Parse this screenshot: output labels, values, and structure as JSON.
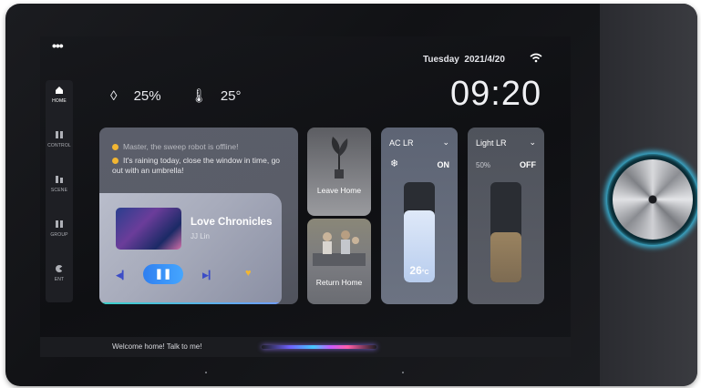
{
  "top": {
    "menu_dots": "•••"
  },
  "nav": {
    "items": [
      {
        "label": "HOME",
        "icon": "home-icon",
        "active": true
      },
      {
        "label": "CONTROL",
        "icon": "control-icon",
        "active": false
      },
      {
        "label": "SCENE",
        "icon": "scene-icon",
        "active": false
      },
      {
        "label": "GROUP",
        "icon": "group-icon",
        "active": false
      },
      {
        "label": "ENT",
        "icon": "entertainment-icon",
        "active": false
      }
    ]
  },
  "weather": {
    "humidity": "25%",
    "temperature": "25°"
  },
  "status": {
    "day": "Tuesday",
    "date": "2021/4/20",
    "time": "09:20",
    "wifi_icon": "wifi-icon"
  },
  "messages": [
    "Master, the sweep robot is offline!",
    "It's raining today, close the window in time, go out with an umbrella!"
  ],
  "music": {
    "title": "Love Chronicles",
    "artist": "JJ Lin",
    "prev_icon": "prev-icon",
    "play_icon": "pause-icon",
    "next_icon": "next-icon",
    "favorite_icon": "heart-icon"
  },
  "scenes": [
    {
      "label": "Leave Home"
    },
    {
      "label": "Return Home"
    }
  ],
  "ac": {
    "name": "AC LR",
    "state": "ON",
    "temp_value": "26",
    "temp_unit": "°C",
    "level": 0.72,
    "mode_icon": "snowflake-icon"
  },
  "light": {
    "name": "Light LR",
    "state": "OFF",
    "percent": "50%",
    "level": 0.5
  },
  "assistant": {
    "welcome": "Welcome home! Talk to me!"
  },
  "colors": {
    "accent_blue": "#3b8ef5",
    "warning_yellow": "#f2b632",
    "knob_glow": "#3cc8f0"
  }
}
